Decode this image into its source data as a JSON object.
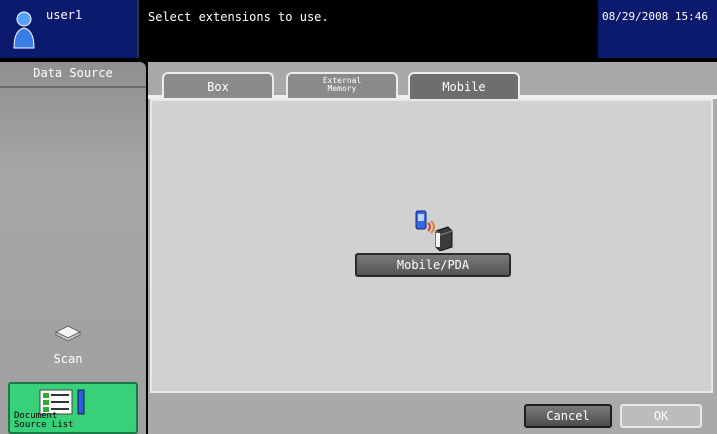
{
  "header": {
    "user": "user1",
    "message": "Select extensions to use.",
    "datetime": "08/29/2008  15:46"
  },
  "left_panel": {
    "title": "Data Source",
    "scan_label": "Scan",
    "doc_list_line1": "Document",
    "doc_list_line2": "Source List"
  },
  "tabs": {
    "box": "Box",
    "external_line1": "External",
    "external_line2": "Memory",
    "mobile": "Mobile"
  },
  "content": {
    "mobile_button": "Mobile/PDA"
  },
  "footer": {
    "cancel": "Cancel",
    "ok": "OK"
  },
  "colors": {
    "header_blue": "#0c1a6e",
    "doc_list_green": "#39d07a"
  }
}
